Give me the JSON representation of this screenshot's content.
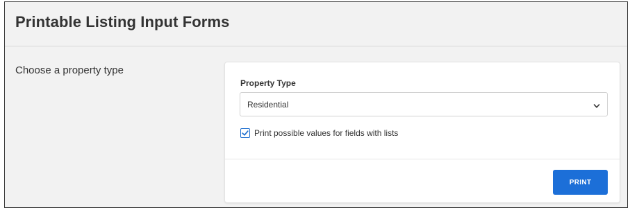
{
  "page": {
    "title": "Printable Listing Input Forms"
  },
  "section": {
    "label": "Choose a property type"
  },
  "form": {
    "property_type_label": "Property Type",
    "property_type_value": "Residential",
    "print_values_checked": true,
    "print_values_label": "Print possible values for fields with lists",
    "print_button_label": "PRINT"
  },
  "colors": {
    "accent": "#1c6fd8",
    "panel_background": "#f2f2f2",
    "card_background": "#ffffff"
  },
  "icons": {
    "dropdown": "chevron-down-icon",
    "checkbox": "checkmark-icon"
  }
}
